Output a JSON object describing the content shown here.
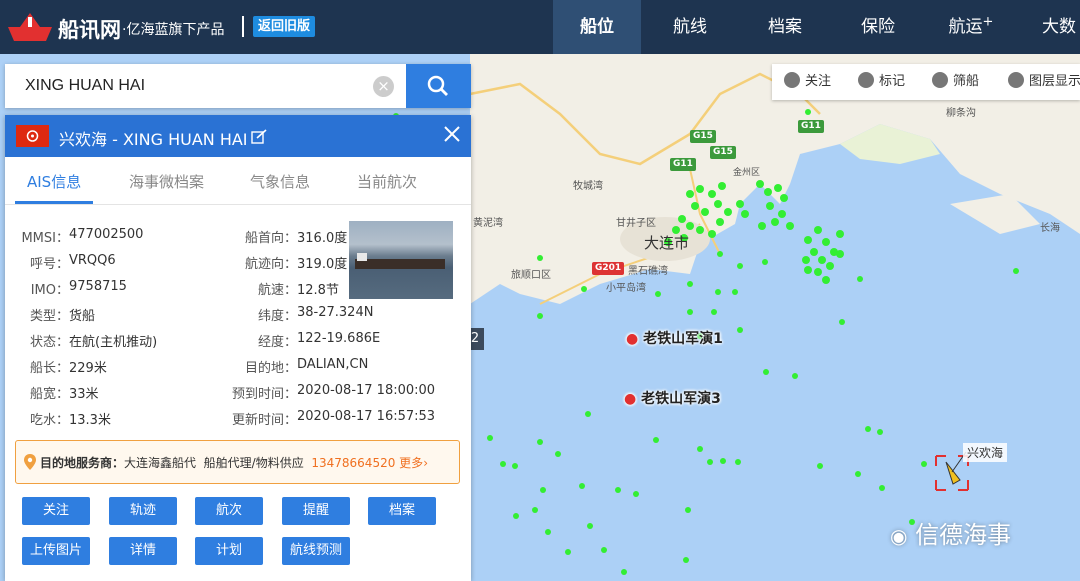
{
  "header": {
    "brand": "船讯网",
    "slogan": "·亿海蓝旗下产品",
    "old_version": "返回旧版",
    "nav": [
      "船位",
      "航线",
      "档案",
      "保险",
      "航运",
      "大数"
    ],
    "nav_plus": "+"
  },
  "toolbar": {
    "follow": "关注",
    "mark": "标记",
    "filter": "筛船",
    "layers": "图层显示"
  },
  "search": {
    "value": "XING HUAN HAI",
    "clear": "×"
  },
  "panel": {
    "title": "兴欢海 -  XING HUAN HAI",
    "tabs": [
      "AIS信息",
      "海事微档案",
      "气象信息",
      "当前航次"
    ],
    "left": [
      {
        "k": "MMSI：",
        "v": "477002500"
      },
      {
        "k": "呼号：",
        "v": "VRQQ6"
      },
      {
        "k": "IMO：",
        "v": "9758715"
      },
      {
        "k": "类型：",
        "v": "货船"
      },
      {
        "k": "状态：",
        "v": "在航(主机推动)"
      },
      {
        "k": "船长：",
        "v": "229米"
      },
      {
        "k": "船宽：",
        "v": "33米"
      },
      {
        "k": "吃水：",
        "v": "13.3米"
      }
    ],
    "right": [
      {
        "k": "船首向：",
        "v": "316.0度"
      },
      {
        "k": "航迹向：",
        "v": "319.0度"
      },
      {
        "k": "航速：",
        "v": "12.8节"
      },
      {
        "k": "纬度：",
        "v": "38-27.324N"
      },
      {
        "k": "经度：",
        "v": "122-19.686E"
      },
      {
        "k": "目的地：",
        "v": "DALIAN,CN"
      },
      {
        "k": "预到时间：",
        "v": "2020-08-17 18:00:00"
      },
      {
        "k": "更新时间：",
        "v": "2020-08-17 16:57:53"
      }
    ],
    "promo": {
      "label": "目的地服务商：",
      "company": "大连海鑫船代",
      "services": "船舶代理/物料供应",
      "phone": "13478664520",
      "more": "更多"
    },
    "buttons": [
      "关注",
      "轨迹",
      "航次",
      "提醒",
      "档案",
      "上传图片",
      "详情",
      "计划",
      "航线预测"
    ]
  },
  "map": {
    "city": "大连市",
    "places": [
      "牧城湾",
      "金州区",
      "甘井子区",
      "黄泥湾",
      "旅顺口区",
      "黑石礁湾",
      "小平岛湾",
      "柳条沟",
      "长海"
    ],
    "highways": [
      "G15",
      "G11",
      "G11",
      "G15",
      "G201"
    ],
    "markers": [
      "老铁山军演1",
      "老铁山军演3"
    ],
    "ship_label": "兴欢海",
    "edge_label": "2"
  },
  "watermark": "信德海事",
  "colors": {
    "header": "#1e3450",
    "accent": "#2f7ee0",
    "sea": "#acd0f6",
    "land": "#f2efe6",
    "ship_dot": "#33ee33"
  }
}
